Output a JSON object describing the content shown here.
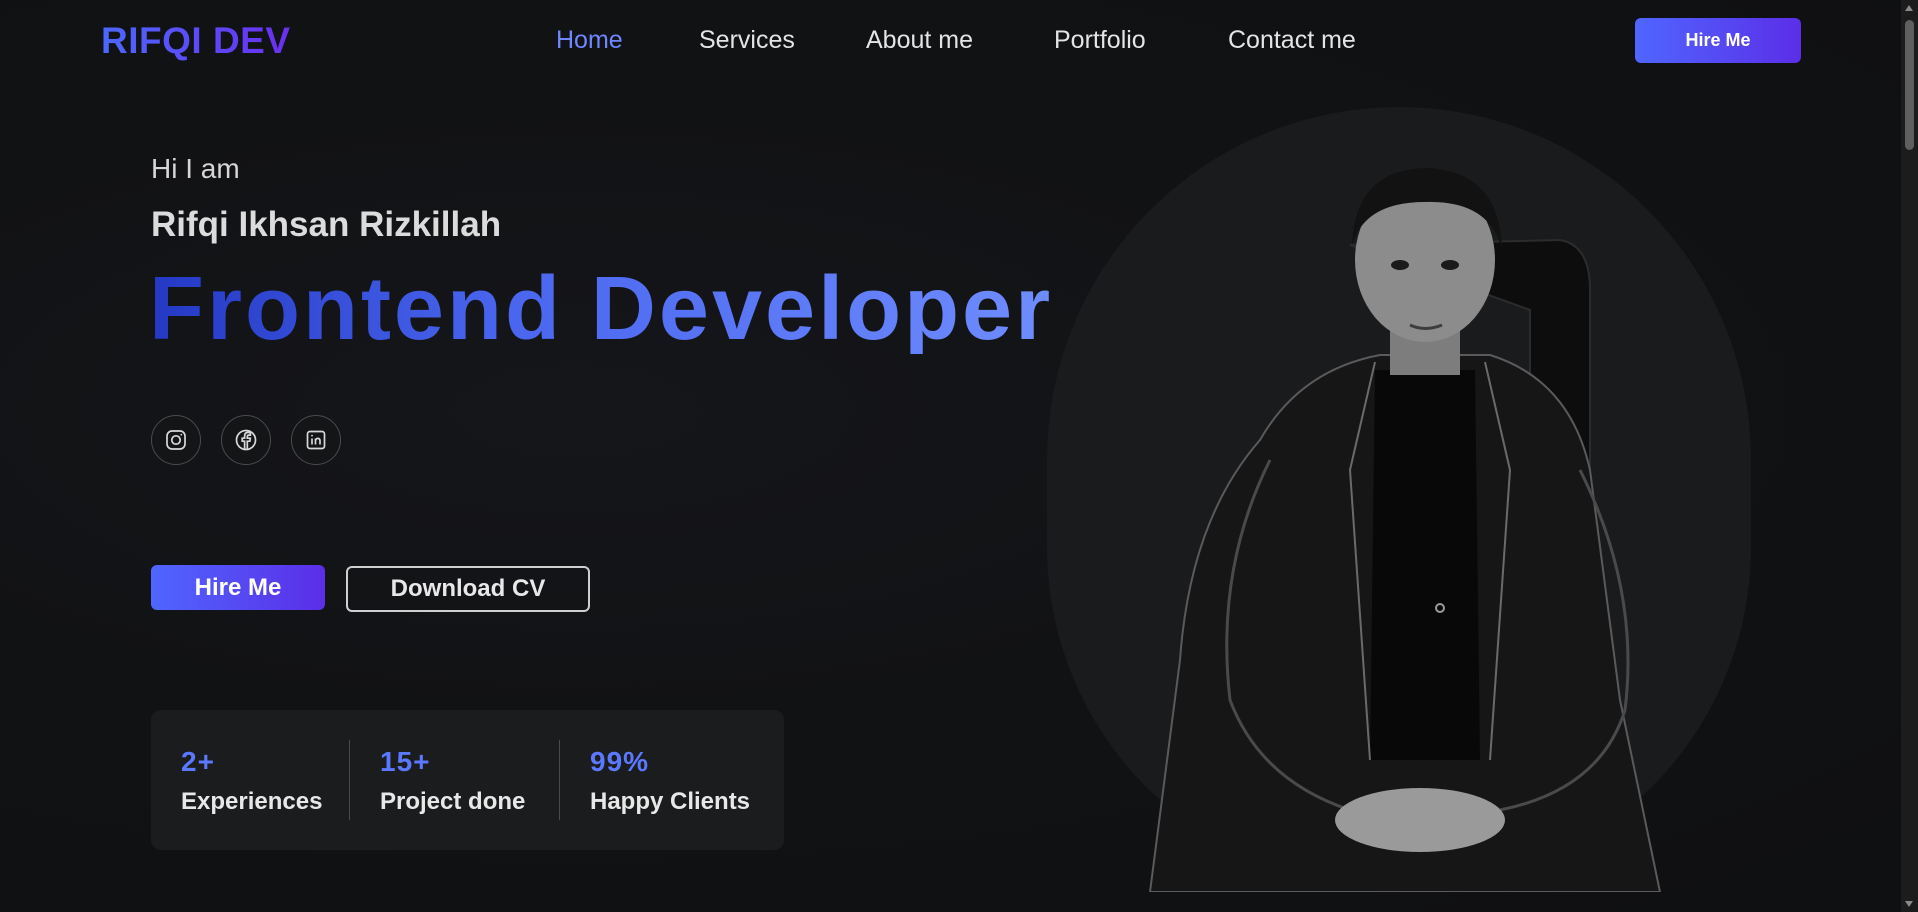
{
  "header": {
    "logo": "RIFQI DEV",
    "nav": [
      {
        "label": "Home",
        "active": true
      },
      {
        "label": "Services",
        "active": false
      },
      {
        "label": "About me",
        "active": false
      },
      {
        "label": "Portfolio",
        "active": false
      },
      {
        "label": "Contact me",
        "active": false
      }
    ],
    "hire_button": "Hire Me"
  },
  "hero": {
    "greeting": "Hi I am",
    "name": "Rifqi Ikhsan Rizkillah",
    "role": "Frontend Developer",
    "socials": [
      {
        "icon": "instagram-icon"
      },
      {
        "icon": "facebook-icon"
      },
      {
        "icon": "linkedin-icon"
      }
    ],
    "hire_button": "Hire Me",
    "cv_button": "Download CV"
  },
  "stats": [
    {
      "value": "2+",
      "label": "Experiences"
    },
    {
      "value": "15+",
      "label": "Project done"
    },
    {
      "value": "99%",
      "label": "Happy Clients"
    }
  ],
  "colors": {
    "accent": "#5b78ff",
    "accent_gradient_start": "#4f66ff",
    "accent_gradient_end": "#5b2ee8",
    "background": "#101112",
    "card": "#1b1c1e"
  }
}
